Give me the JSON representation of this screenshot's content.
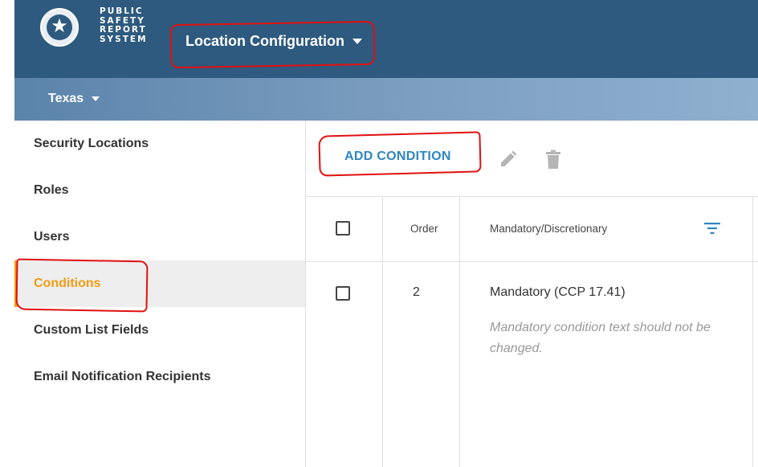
{
  "header": {
    "brand_lines": [
      "PUBLIC",
      "SAFETY",
      "REPORT",
      "SYSTEM"
    ],
    "app_menu_label": "Location Configuration",
    "bg_color": "#2d5a7e"
  },
  "subbar": {
    "state_label": "Texas"
  },
  "sidebar": {
    "items": [
      {
        "label": "Security Locations"
      },
      {
        "label": "Roles"
      },
      {
        "label": "Users"
      },
      {
        "label": "Conditions"
      },
      {
        "label": "Custom List Fields"
      },
      {
        "label": "Email Notification Recipients"
      }
    ],
    "active_item": "Conditions",
    "accent_color": "#f39c12"
  },
  "toolbar": {
    "add_label": "ADD CONDITION",
    "edit_icon": "pencil-icon",
    "delete_icon": "trash-icon"
  },
  "table": {
    "columns": [
      "Order",
      "Mandatory/Discretionary"
    ],
    "rows": [
      {
        "order": "2",
        "type": "Mandatory (CCP 17.41)",
        "note": "Mandatory condition text should not be changed."
      }
    ]
  }
}
